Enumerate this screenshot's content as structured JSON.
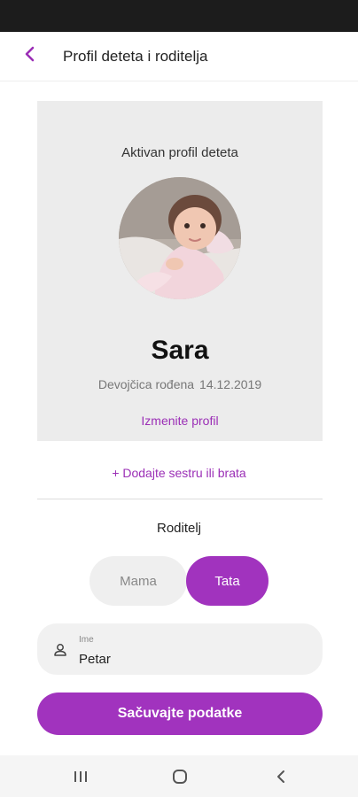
{
  "header": {
    "title": "Profil deteta i roditelja",
    "back_icon": "chevron-left-icon"
  },
  "profile_card": {
    "heading": "Aktivan profil deteta",
    "child_name": "Sara",
    "child_description": "Devojčica rođena",
    "birth_date": "14.12.2019",
    "edit_link": "Izmenite profil"
  },
  "add_sibling": "+ Dodajte sestru ili brata",
  "parent": {
    "label": "Roditelj",
    "options": [
      "Mama",
      "Tata"
    ],
    "selected": "Tata"
  },
  "name_field": {
    "label": "Ime",
    "value": "Petar",
    "icon": "person-icon"
  },
  "save_button": "Sačuvajte podatke",
  "nav_bar": {
    "icons": [
      "recent-apps-icon",
      "home-icon",
      "back-icon"
    ]
  },
  "colors": {
    "accent": "#a133be",
    "link": "#9b2fb6",
    "card_bg": "#ececec",
    "field_bg": "#f1f1f1"
  }
}
